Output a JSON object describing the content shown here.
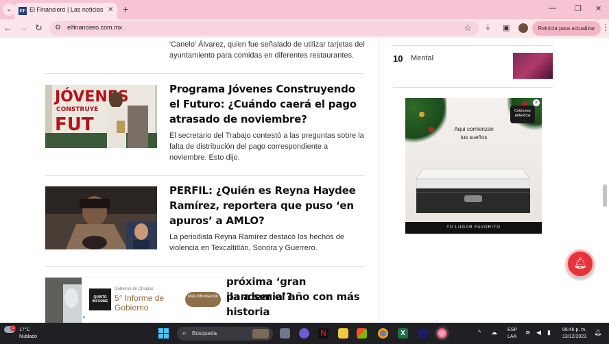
{
  "browser": {
    "tab_title": "El Financiero | Las noticias de fi",
    "tab_favicon": "EF",
    "url": "elfinanciero.com.mx",
    "update_label": "Reinicia para actualizar"
  },
  "articles": {
    "top_summary": "'Canelo' Álvarez, quien fue señalado de utilizar tarjetas del ayuntamiento para comidas en diferentes restaurantes.",
    "items": [
      {
        "headline": "Programa Jóvenes Construyendo el Futuro: ¿Cuándo caerá el pago atrasado de noviembre?",
        "summary": "El secretario del Trabajo contestó a las preguntas sobre la falta de distribución del pago correspondiente a noviembre. Esto dijo.",
        "image_text": "JÓVENES CONSTRUYENDO EL FUTURO"
      },
      {
        "headline": "PERFIL: ¿Quién es Reyna Haydee Ramírez, reportera que puso ‘en apuros’ a AMLO?",
        "summary": "La periodista Reyna Ramírez destacó los hechos de violencia en Texcaltitlán, Sonora y Guerrero."
      },
      {
        "headline": "¿La próxima ‘gran pandemia’? ...ila a ser el año con más ...historia",
        "headline_lines": [
          "próxima ‘gran pandemia’?",
          "ila a ser el año con más",
          "historia"
        ]
      }
    ]
  },
  "sidebar": {
    "rank_number": "10",
    "rank_label": "Mental",
    "ad": {
      "brand": "Colchones AMERICA",
      "tagline_1": "Aquí comienzan",
      "tagline_2": "tus sueños",
      "footer": "TU LUGAR FAVORITO",
      "close": "×"
    }
  },
  "gov_ad": {
    "small": "Gobierno de Chiapas",
    "logo_text": "QUINTO INFORME",
    "big_1": "5° Informe de",
    "big_2": "Gobierno",
    "button": "Más información"
  },
  "taskbar": {
    "temp": "17°C",
    "weather": "Nublado",
    "weather_badge": "1",
    "search_placeholder": "Búsqueda",
    "lang_1": "ESP",
    "lang_2": "LAA",
    "time": "06:46 p. m.",
    "date": "13/12/2023"
  }
}
